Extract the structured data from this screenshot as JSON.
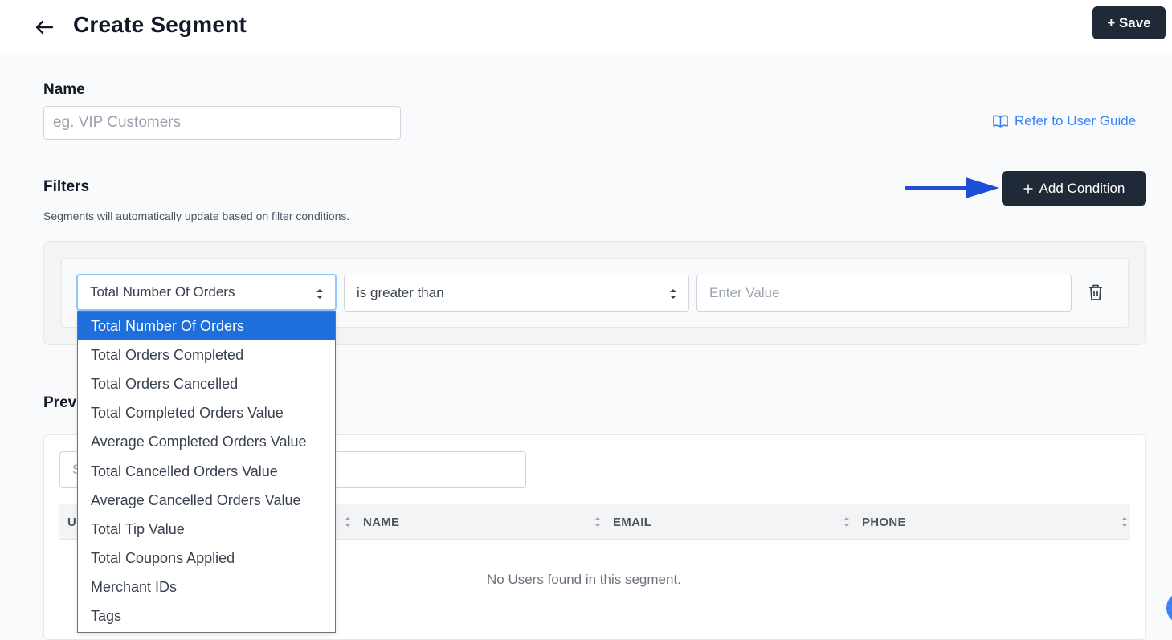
{
  "header": {
    "title": "Create Segment",
    "save_label": "+ Save"
  },
  "name_section": {
    "label": "Name",
    "placeholder": "eg. VIP Customers",
    "guide_link": "Refer to User Guide"
  },
  "filters": {
    "label": "Filters",
    "description": "Segments will automatically update based on filter conditions.",
    "add_condition_label": "Add Condition",
    "condition": {
      "field": "Total Number Of Orders",
      "operator": "is greater than",
      "value_placeholder": "Enter Value"
    },
    "field_options": [
      "Total Number Of Orders",
      "Total Orders Completed",
      "Total Orders Cancelled",
      "Total Completed Orders Value",
      "Average Completed Orders Value",
      "Total Cancelled Orders Value",
      "Average Cancelled Orders Value",
      "Total Tip Value",
      "Total Coupons Applied",
      "Merchant IDs",
      "Tags"
    ],
    "selected_index": 0
  },
  "preview": {
    "label": "Prev",
    "search_placeholder": "S",
    "columns": [
      "U",
      "NAME",
      "EMAIL",
      "PHONE"
    ],
    "empty_message": "No Users found in this segment."
  },
  "colors": {
    "dark_button": "#1f2937",
    "link_blue": "#3b82f6",
    "selected_option": "#1e6fdc",
    "annotation_arrow": "#1d4ed8"
  },
  "icons": {
    "back": "arrow-left-icon",
    "guide": "book-open-icon",
    "add": "plus-icon",
    "caret": "select-caret-icon",
    "delete": "trash-icon",
    "sort": "sort-icon",
    "annotation": "annotation-arrow-icon"
  }
}
